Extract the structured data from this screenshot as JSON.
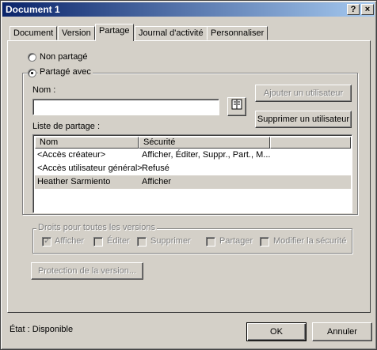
{
  "window": {
    "title": "Document 1",
    "help_button": "?",
    "close_button": "×"
  },
  "tabs": [
    {
      "label": "Document"
    },
    {
      "label": "Version"
    },
    {
      "label": "Partage"
    },
    {
      "label": "Journal d'activité"
    },
    {
      "label": "Personnaliser"
    }
  ],
  "active_tab": "Partage",
  "sharing": {
    "not_shared_label": "Non partagé",
    "shared_with_label": "Partagé avec",
    "selected_option": "Partagé avec",
    "name_label": "Nom :",
    "name_value": "",
    "add_user_button": "Ajouter un utilisateur",
    "remove_user_button": "Supprimer un utilisateur",
    "share_list_label": "Liste de partage :",
    "columns": [
      "Nom",
      "Sécurité"
    ],
    "rows": [
      {
        "name": "<Accès créateur>",
        "security": "Afficher, Éditer, Suppr., Part., M..."
      },
      {
        "name": "<Accès utilisateur général>",
        "security": "Refusé"
      },
      {
        "name": "Heather Sarmiento",
        "security": "Afficher"
      }
    ],
    "selected_row": 2
  },
  "rights": {
    "group_label": "Droits pour toutes les versions",
    "options": [
      {
        "label": "Afficher",
        "checked": true
      },
      {
        "label": "Éditer",
        "checked": false
      },
      {
        "label": "Supprimer",
        "checked": false
      },
      {
        "label": "Partager",
        "checked": false
      },
      {
        "label": "Modifier la sécurité",
        "checked": false
      }
    ]
  },
  "protect_button": "Protection de la version...",
  "status": "État : Disponible",
  "ok_button": "OK",
  "cancel_button": "Annuler",
  "icons": {
    "address_book": "address-book-icon"
  }
}
